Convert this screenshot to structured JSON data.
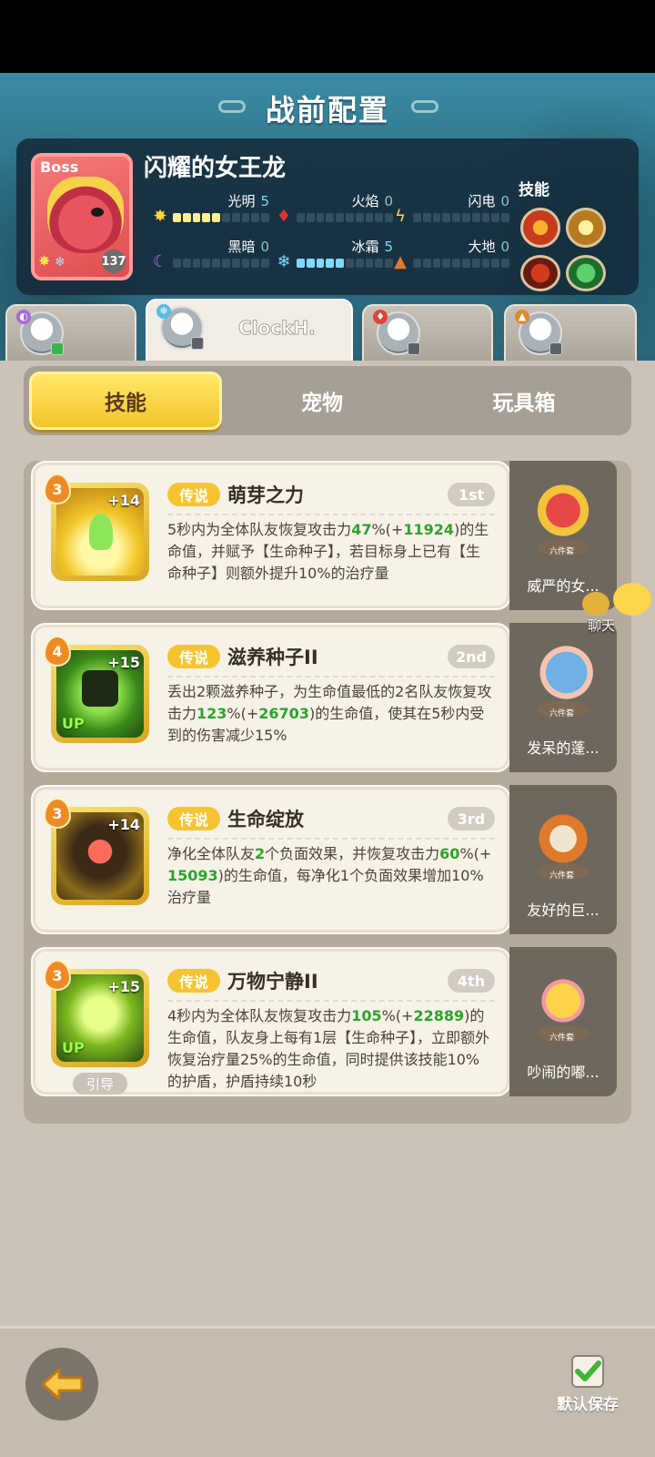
{
  "page_title": "战前配置",
  "boss": {
    "tag": "Boss",
    "name": "闪耀的女王龙",
    "level": "137",
    "stats": [
      {
        "label": "光明",
        "value": "5",
        "filled": 5,
        "icon": "sun-icon"
      },
      {
        "label": "火焰",
        "value": "0",
        "filled": 0,
        "icon": "flame-icon"
      },
      {
        "label": "闪电",
        "value": "0",
        "filled": 0,
        "icon": "lightning-icon"
      },
      {
        "label": "黑暗",
        "value": "0",
        "filled": 0,
        "icon": "moon-icon"
      },
      {
        "label": "冰霜",
        "value": "5",
        "filled": 5,
        "icon": "snowflake-icon"
      },
      {
        "label": "大地",
        "value": "0",
        "filled": 0,
        "icon": "mountain-icon"
      }
    ],
    "skills_label": "技能"
  },
  "heroes": [
    {
      "name": ""
    },
    {
      "name": "ClockH."
    },
    {
      "name": ""
    },
    {
      "name": ""
    }
  ],
  "tabs": [
    "技能",
    "宠物",
    "玩具箱"
  ],
  "active_tab": "技能",
  "skills": [
    {
      "level": "3",
      "plus": "+14",
      "rarity": "传说",
      "name": "萌芽之力",
      "rank": "1st",
      "desc_parts": [
        "5秒内为全体队友恢复攻击力",
        "47",
        "%(+",
        "11924",
        ")的生命值，并赋予【生命种子】，若目标身上已有【生命种子】则额外提升10%的治疗量"
      ],
      "side_label": "威严的女...",
      "up": "",
      "guide": ""
    },
    {
      "level": "4",
      "plus": "+15",
      "rarity": "传说",
      "name": "滋养种子II",
      "rank": "2nd",
      "desc_parts": [
        "丢出2颗滋养种子，为生命值最低的2名队友恢复攻击力",
        "123",
        "%(+",
        "26703",
        ")的生命值，使其在5秒内受到的伤害减少15%"
      ],
      "side_label": "发呆的蓬...",
      "up": "UP",
      "guide": ""
    },
    {
      "level": "3",
      "plus": "+14",
      "rarity": "传说",
      "name": "生命绽放",
      "rank": "3rd",
      "desc_parts": [
        "净化全体队友",
        "2",
        "个负面效果，并恢复攻击力",
        "60",
        "%(+",
        "15093",
        ")的生命值，每净化1个负面效果增加10%治疗量"
      ],
      "side_label": "友好的巨...",
      "up": "",
      "guide": ""
    },
    {
      "level": "3",
      "plus": "+15",
      "rarity": "传说",
      "name": "万物宁静II",
      "rank": "4th",
      "desc_parts": [
        "4秒内为全体队友恢复攻击力",
        "105",
        "%(+",
        "22889",
        ")的生命值，队友身上每有1层【生命种子】，立即额外恢复治疗量25%的生命值，同时提供该技能10%的护盾，护盾持续10秒"
      ],
      "side_label": "吵闹的嘟...",
      "up": "UP",
      "guide": "引导"
    }
  ],
  "six_set_label": "六件套",
  "chat_label": "聊天",
  "save_label": "默认保存",
  "colors": {
    "accent": "#f7c431",
    "green_value": "#2aa52c",
    "light_blue": "#7fd9ff"
  }
}
